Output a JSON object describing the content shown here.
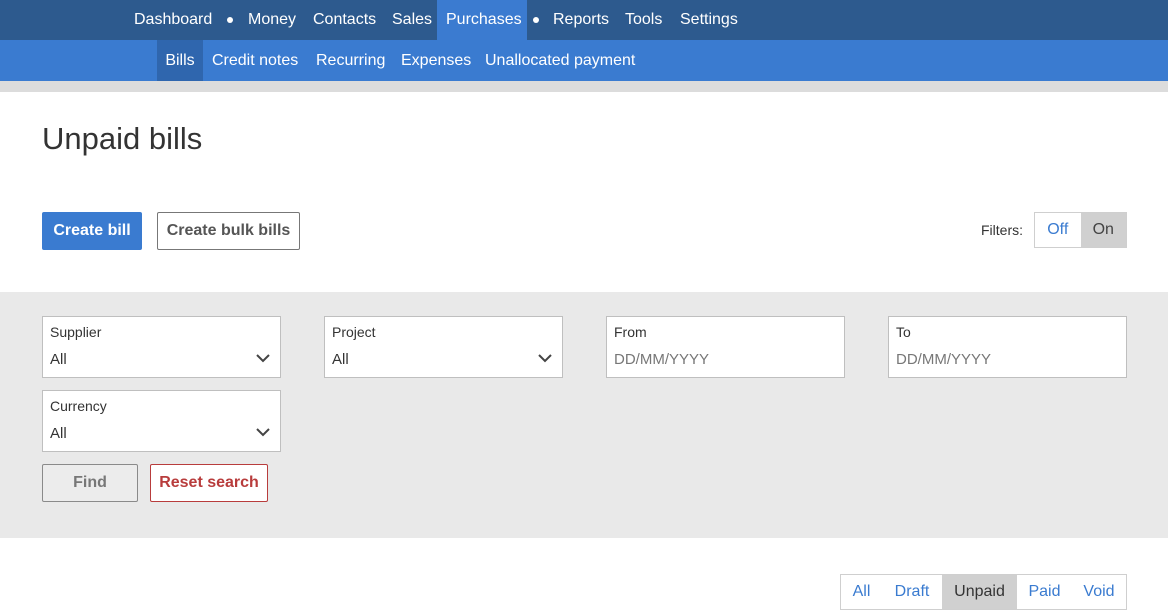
{
  "top_nav": {
    "dashboard": "Dashboard",
    "money": "Money",
    "contacts": "Contacts",
    "sales": "Sales",
    "purchases": "Purchases",
    "reports": "Reports",
    "tools": "Tools",
    "settings": "Settings"
  },
  "sub_nav": {
    "bills": "Bills",
    "credit_notes": "Credit notes",
    "recurring": "Recurring",
    "expenses": "Expenses",
    "unallocated_payment": "Unallocated payment"
  },
  "page": {
    "title": "Unpaid bills",
    "create_bill": "Create bill",
    "create_bulk_bills": "Create bulk bills"
  },
  "filters_toggle": {
    "label": "Filters:",
    "off": "Off",
    "on": "On",
    "selected": "On"
  },
  "filters": {
    "supplier": {
      "label": "Supplier",
      "value": "All"
    },
    "project": {
      "label": "Project",
      "value": "All"
    },
    "from": {
      "label": "From",
      "placeholder": "DD/MM/YYYY"
    },
    "to": {
      "label": "To",
      "placeholder": "DD/MM/YYYY"
    },
    "currency": {
      "label": "Currency",
      "value": "All"
    },
    "find": "Find",
    "reset": "Reset search"
  },
  "status_tabs": {
    "all": "All",
    "draft": "Draft",
    "unpaid": "Unpaid",
    "paid": "Paid",
    "void": "Void",
    "selected": "Unpaid"
  },
  "colors": {
    "top_nav_bg": "#2d5a8e",
    "sub_nav_bg": "#3a7bd0",
    "primary": "#3a7bd0",
    "danger": "#b83c3c",
    "panel_bg": "#e9e9e9"
  }
}
